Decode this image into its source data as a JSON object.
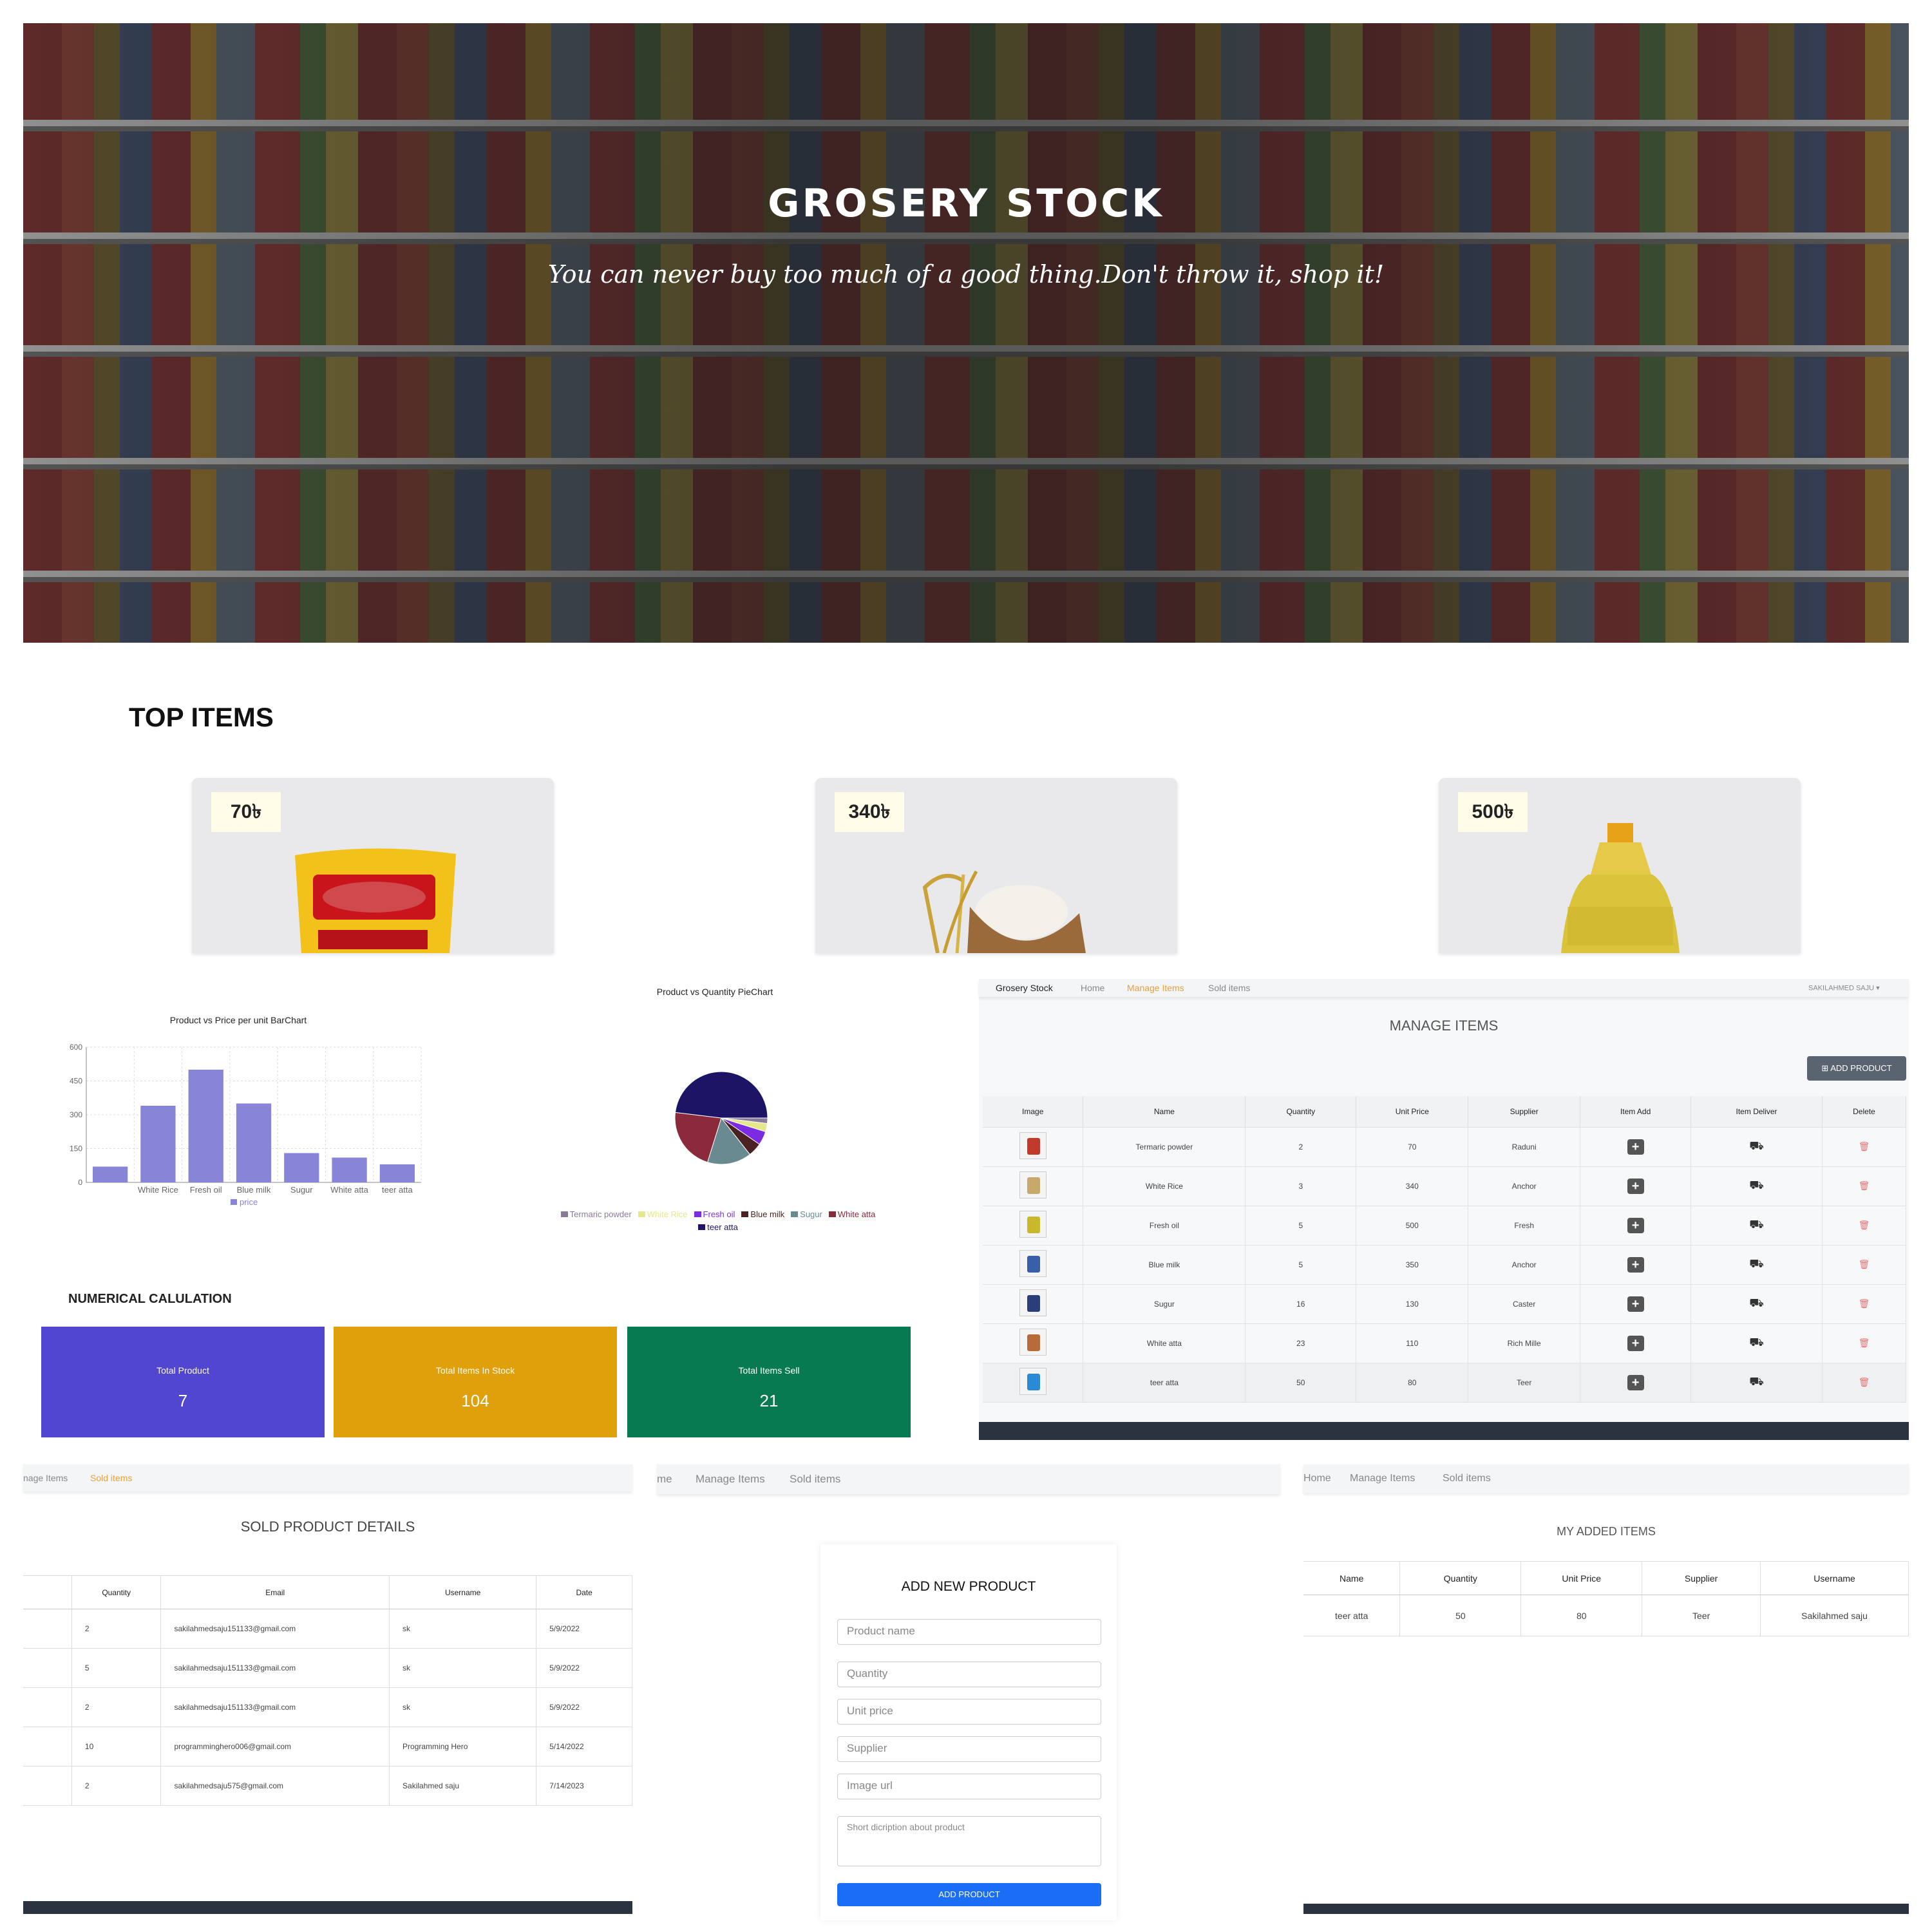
{
  "hero": {
    "title": "GROSERY STOCK",
    "tagline": "You can never buy too much of a good thing.Don't throw it, shop it!"
  },
  "top_items": {
    "heading": "TOP ITEMS",
    "cards": [
      {
        "price": "70৳"
      },
      {
        "price": "340৳"
      },
      {
        "price": "500৳"
      }
    ]
  },
  "bar_chart_title": "Product vs Price per unit BarChart",
  "pie_chart_title": "Product vs Quantity PieChart",
  "chart_data": [
    {
      "type": "bar",
      "title": "Product vs Price per unit BarChart",
      "categories": [
        "Termaric powder",
        "White Rice",
        "Fresh oil",
        "Blue milk",
        "Sugur",
        "White atta",
        "teer atta"
      ],
      "tick_labels_shown": [
        "",
        "White Rice",
        "Fresh oil",
        "Blue milk",
        "Sugur",
        "White atta",
        "teer atta"
      ],
      "series": [
        {
          "name": "price",
          "values": [
            70,
            340,
            500,
            350,
            130,
            110,
            80
          ]
        }
      ],
      "ylim": [
        0,
        600
      ],
      "yticks": [
        "0",
        "150",
        "300",
        "450",
        "600"
      ],
      "grid": true,
      "legend": "bottom",
      "color": "#8884d8"
    },
    {
      "type": "pie",
      "title": "Product vs Quantity PieChart",
      "categories": [
        "Termaric powder",
        "White Rice",
        "Fresh oil",
        "Blue milk",
        "Sugur",
        "White atta",
        "teer atta"
      ],
      "values": [
        2,
        3,
        5,
        5,
        16,
        23,
        50
      ],
      "colors": [
        "#8a7a9a",
        "#e6e68a",
        "#7b2be2",
        "#4a2222",
        "#6a8a92",
        "#8a2a3a",
        "#1e1466"
      ],
      "legend": "bottom"
    }
  ],
  "numerical": {
    "heading": "NUMERICAL CALULATION",
    "stats": [
      {
        "label": "Total Product",
        "value": "7",
        "color": "#5046d0"
      },
      {
        "label": "Total Items In Stock",
        "value": "104",
        "color": "#e0a00c"
      },
      {
        "label": "Total Items Sell",
        "value": "21",
        "color": "#087a52"
      }
    ]
  },
  "manage": {
    "nav": {
      "brand": "Grosery Stock",
      "home": "Home",
      "manage": "Manage Items",
      "sold": "Sold items",
      "user": "SAKILAHMED SAJU"
    },
    "title": "MANAGE ITEMS",
    "add_button": "ADD PRODUCT",
    "headers": [
      "Image",
      "Name",
      "Quantity",
      "Unit Price",
      "Supplier",
      "Item Add",
      "Item Deliver",
      "Delete"
    ],
    "rows": [
      {
        "name": "Termaric powder",
        "qty": "2",
        "price": "70",
        "supplier": "Raduni",
        "thumb": "#c0392b"
      },
      {
        "name": "White Rice",
        "qty": "3",
        "price": "340",
        "supplier": "Anchor",
        "thumb": "#c9a86b"
      },
      {
        "name": "Fresh oil",
        "qty": "5",
        "price": "500",
        "supplier": "Fresh",
        "thumb": "#c9b82a"
      },
      {
        "name": "Blue milk",
        "qty": "5",
        "price": "350",
        "supplier": "Anchor",
        "thumb": "#3b5ea8"
      },
      {
        "name": "Sugur",
        "qty": "16",
        "price": "130",
        "supplier": "Caster",
        "thumb": "#2c3e7a"
      },
      {
        "name": "White atta",
        "qty": "23",
        "price": "110",
        "supplier": "Rich Mille",
        "thumb": "#b86b3a"
      },
      {
        "name": "teer atta",
        "qty": "50",
        "price": "80",
        "supplier": "Teer",
        "thumb": "#2a8ad8"
      }
    ]
  },
  "sold": {
    "nav": {
      "manage": "nage Items",
      "sold": "Sold items"
    },
    "title": "SOLD PRODUCT DETAILS",
    "headers": [
      "",
      "Quantity",
      "Email",
      "Username",
      "Date"
    ],
    "rows": [
      {
        "qty": "2",
        "email": "sakilahmedsaju151133@gmail.com",
        "user": "sk",
        "date": "5/9/2022"
      },
      {
        "qty": "5",
        "email": "sakilahmedsaju151133@gmail.com",
        "user": "sk",
        "date": "5/9/2022"
      },
      {
        "qty": "2",
        "email": "sakilahmedsaju151133@gmail.com",
        "user": "sk",
        "date": "5/9/2022"
      },
      {
        "qty": "10",
        "email": "programminghero006@gmail.com",
        "user": "Programming Hero",
        "date": "5/14/2022"
      },
      {
        "qty": "2",
        "email": "sakilahmedsaju575@gmail.com",
        "user": "Sakilahmed saju",
        "date": "7/14/2023"
      }
    ]
  },
  "add_form": {
    "nav": {
      "home": "me",
      "manage": "Manage Items",
      "sold": "Sold items"
    },
    "title": "ADD NEW PRODUCT",
    "placeholders": {
      "name": "Product name",
      "quantity": "Quantity",
      "price": "Unit price",
      "supplier": "Supplier",
      "image": "Image url",
      "desc": "Short dicription about product"
    },
    "submit": "ADD PRODUCT"
  },
  "my_items": {
    "nav": {
      "home": "Home",
      "manage": "Manage Items",
      "sold": "Sold items"
    },
    "title": "MY ADDED ITEMS",
    "headers": [
      "Name",
      "Quantity",
      "Unit Price",
      "Supplier",
      "Username"
    ],
    "rows": [
      {
        "name": "teer atta",
        "qty": "50",
        "price": "80",
        "supplier": "Teer",
        "user": "Sakilahmed saju"
      }
    ]
  }
}
